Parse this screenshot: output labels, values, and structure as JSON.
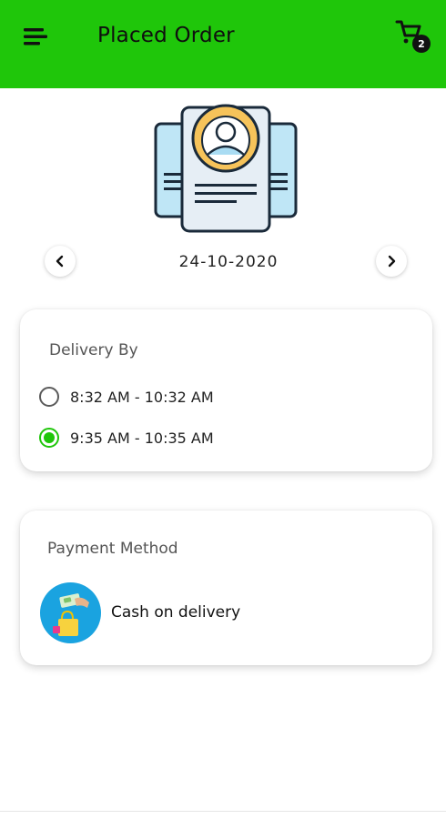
{
  "header": {
    "title": "Placed Order",
    "cart_count": "2",
    "background_color": "#1fc60a",
    "menu_icon": "hamburger-menu-icon",
    "cart_icon": "shopping-cart-icon"
  },
  "date_nav": {
    "date": "24-10-2020",
    "prev_icon": "chevron-left-icon",
    "next_icon": "chevron-right-icon"
  },
  "delivery": {
    "heading": "Delivery By",
    "options": [
      {
        "label": "8:32 AM - 10:32 AM",
        "selected": false
      },
      {
        "label": "9:35 AM - 10:35 AM",
        "selected": true
      }
    ],
    "accent_color": "#1fc60a"
  },
  "payment": {
    "heading": "Payment Method",
    "method_label": "Cash on delivery",
    "method_icon": "cash-on-delivery-icon",
    "icon_background": "#1aa3e0"
  }
}
